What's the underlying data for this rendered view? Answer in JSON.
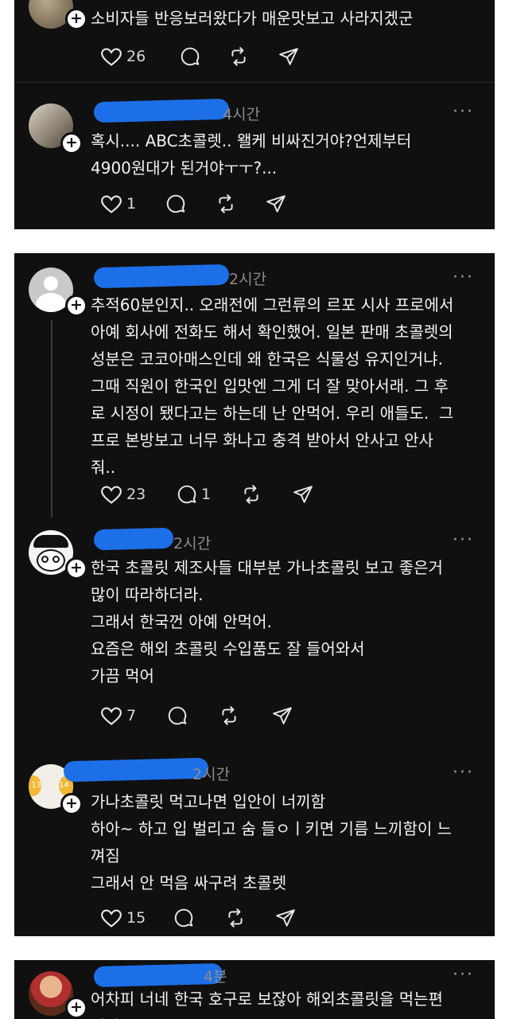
{
  "card1": {
    "post1": {
      "text": "소비자들 반응보러왔다가 매운맛보고 사라지겠군",
      "likes": "26"
    },
    "post2": {
      "time": "4시간",
      "more": "···",
      "text": "혹시.... ABC초콜렛.. 왤케 비싸진거야?언제부터\n4900원대가 된거야ㅜㅜ?...",
      "likes": "1"
    }
  },
  "card2": {
    "post1": {
      "time": "2시간",
      "more": "···",
      "text": "추적60분인지.. 오래전에 그런류의 르포 시사 프로에서\n아예 회사에 전화도 해서 확인했어. 일본 판매 초콜렛의\n성분은 코코아매스인데 왜 한국은 식물성 유지인거냐.\n그때 직원이 한국인 입맛엔 그게 더 잘 맞아서래. 그 후\n로 시정이 됐다고는 하는데 난 안먹어. 우리 애들도.  그\n프로 본방보고 너무 화나고 충격 받아서 안사고 안사\n줘..",
      "likes": "23",
      "replies": "1"
    },
    "post2": {
      "time": "2시간",
      "more": "···",
      "text": "한국 초콜릿 제조사들 대부분 가나초콜릿 보고 좋은거\n많이 따라하더라.\n그래서 한국껀 아예 안먹어.\n요즘은 해외 초콜릿 수입품도 잘 들어와서\n가끔 먹어",
      "likes": "7"
    },
    "post3": {
      "time": "2시간",
      "more": "···",
      "text": "가나초콜릿 먹고나면 입안이 너끼함\n하아~ 하고 입 벌리고 숨 들ㅇㅣ키면 기름 느끼함이 느\n껴짐\n그래서 안 먹음 싸구려 초콜렛",
      "likes": "15",
      "avatar_text_left": "13",
      "avatar_text_right": "14"
    }
  },
  "card3": {
    "post1": {
      "time": "4분",
      "more": "···",
      "text": "어차피 너네 한국 호구로 보잖아 해외초콜릿을 먹는편\n이야"
    }
  },
  "colors": {
    "card_bg": "#101010",
    "name_censor": "#1d6fe8",
    "text": "#f2f2f2",
    "muted": "#8c8c8c"
  },
  "icons": [
    "heart-icon",
    "comment-icon",
    "repost-icon",
    "share-icon",
    "more-icon",
    "follow-plus-icon"
  ]
}
